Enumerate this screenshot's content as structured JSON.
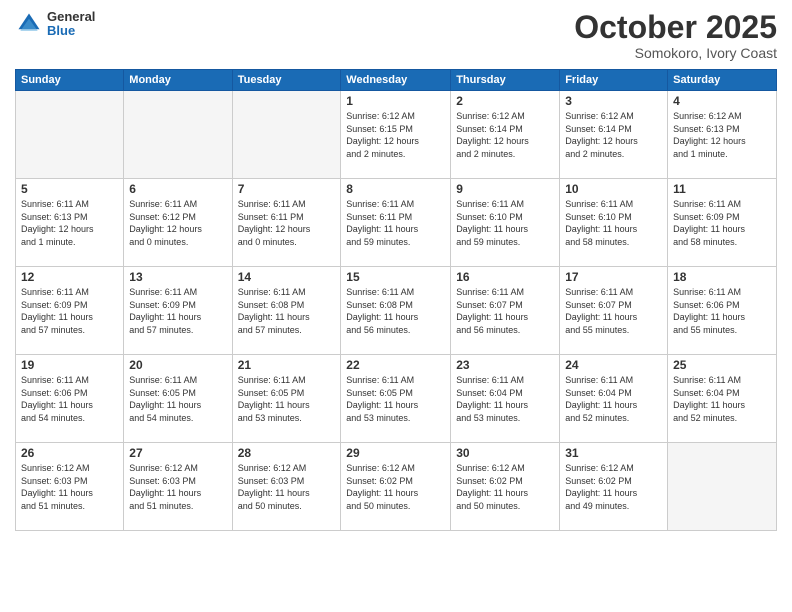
{
  "header": {
    "logo_general": "General",
    "logo_blue": "Blue",
    "month": "October 2025",
    "location": "Somokoro, Ivory Coast"
  },
  "weekdays": [
    "Sunday",
    "Monday",
    "Tuesday",
    "Wednesday",
    "Thursday",
    "Friday",
    "Saturday"
  ],
  "weeks": [
    [
      {
        "day": "",
        "empty": true
      },
      {
        "day": "",
        "empty": true
      },
      {
        "day": "",
        "empty": true
      },
      {
        "day": "1",
        "info": "Sunrise: 6:12 AM\nSunset: 6:15 PM\nDaylight: 12 hours\nand 2 minutes."
      },
      {
        "day": "2",
        "info": "Sunrise: 6:12 AM\nSunset: 6:14 PM\nDaylight: 12 hours\nand 2 minutes."
      },
      {
        "day": "3",
        "info": "Sunrise: 6:12 AM\nSunset: 6:14 PM\nDaylight: 12 hours\nand 2 minutes."
      },
      {
        "day": "4",
        "info": "Sunrise: 6:12 AM\nSunset: 6:13 PM\nDaylight: 12 hours\nand 1 minute."
      }
    ],
    [
      {
        "day": "5",
        "info": "Sunrise: 6:11 AM\nSunset: 6:13 PM\nDaylight: 12 hours\nand 1 minute."
      },
      {
        "day": "6",
        "info": "Sunrise: 6:11 AM\nSunset: 6:12 PM\nDaylight: 12 hours\nand 0 minutes."
      },
      {
        "day": "7",
        "info": "Sunrise: 6:11 AM\nSunset: 6:11 PM\nDaylight: 12 hours\nand 0 minutes."
      },
      {
        "day": "8",
        "info": "Sunrise: 6:11 AM\nSunset: 6:11 PM\nDaylight: 11 hours\nand 59 minutes."
      },
      {
        "day": "9",
        "info": "Sunrise: 6:11 AM\nSunset: 6:10 PM\nDaylight: 11 hours\nand 59 minutes."
      },
      {
        "day": "10",
        "info": "Sunrise: 6:11 AM\nSunset: 6:10 PM\nDaylight: 11 hours\nand 58 minutes."
      },
      {
        "day": "11",
        "info": "Sunrise: 6:11 AM\nSunset: 6:09 PM\nDaylight: 11 hours\nand 58 minutes."
      }
    ],
    [
      {
        "day": "12",
        "info": "Sunrise: 6:11 AM\nSunset: 6:09 PM\nDaylight: 11 hours\nand 57 minutes."
      },
      {
        "day": "13",
        "info": "Sunrise: 6:11 AM\nSunset: 6:09 PM\nDaylight: 11 hours\nand 57 minutes."
      },
      {
        "day": "14",
        "info": "Sunrise: 6:11 AM\nSunset: 6:08 PM\nDaylight: 11 hours\nand 57 minutes."
      },
      {
        "day": "15",
        "info": "Sunrise: 6:11 AM\nSunset: 6:08 PM\nDaylight: 11 hours\nand 56 minutes."
      },
      {
        "day": "16",
        "info": "Sunrise: 6:11 AM\nSunset: 6:07 PM\nDaylight: 11 hours\nand 56 minutes."
      },
      {
        "day": "17",
        "info": "Sunrise: 6:11 AM\nSunset: 6:07 PM\nDaylight: 11 hours\nand 55 minutes."
      },
      {
        "day": "18",
        "info": "Sunrise: 6:11 AM\nSunset: 6:06 PM\nDaylight: 11 hours\nand 55 minutes."
      }
    ],
    [
      {
        "day": "19",
        "info": "Sunrise: 6:11 AM\nSunset: 6:06 PM\nDaylight: 11 hours\nand 54 minutes."
      },
      {
        "day": "20",
        "info": "Sunrise: 6:11 AM\nSunset: 6:05 PM\nDaylight: 11 hours\nand 54 minutes."
      },
      {
        "day": "21",
        "info": "Sunrise: 6:11 AM\nSunset: 6:05 PM\nDaylight: 11 hours\nand 53 minutes."
      },
      {
        "day": "22",
        "info": "Sunrise: 6:11 AM\nSunset: 6:05 PM\nDaylight: 11 hours\nand 53 minutes."
      },
      {
        "day": "23",
        "info": "Sunrise: 6:11 AM\nSunset: 6:04 PM\nDaylight: 11 hours\nand 53 minutes."
      },
      {
        "day": "24",
        "info": "Sunrise: 6:11 AM\nSunset: 6:04 PM\nDaylight: 11 hours\nand 52 minutes."
      },
      {
        "day": "25",
        "info": "Sunrise: 6:11 AM\nSunset: 6:04 PM\nDaylight: 11 hours\nand 52 minutes."
      }
    ],
    [
      {
        "day": "26",
        "info": "Sunrise: 6:12 AM\nSunset: 6:03 PM\nDaylight: 11 hours\nand 51 minutes."
      },
      {
        "day": "27",
        "info": "Sunrise: 6:12 AM\nSunset: 6:03 PM\nDaylight: 11 hours\nand 51 minutes."
      },
      {
        "day": "28",
        "info": "Sunrise: 6:12 AM\nSunset: 6:03 PM\nDaylight: 11 hours\nand 50 minutes."
      },
      {
        "day": "29",
        "info": "Sunrise: 6:12 AM\nSunset: 6:02 PM\nDaylight: 11 hours\nand 50 minutes."
      },
      {
        "day": "30",
        "info": "Sunrise: 6:12 AM\nSunset: 6:02 PM\nDaylight: 11 hours\nand 50 minutes."
      },
      {
        "day": "31",
        "info": "Sunrise: 6:12 AM\nSunset: 6:02 PM\nDaylight: 11 hours\nand 49 minutes."
      },
      {
        "day": "",
        "empty": true
      }
    ]
  ]
}
